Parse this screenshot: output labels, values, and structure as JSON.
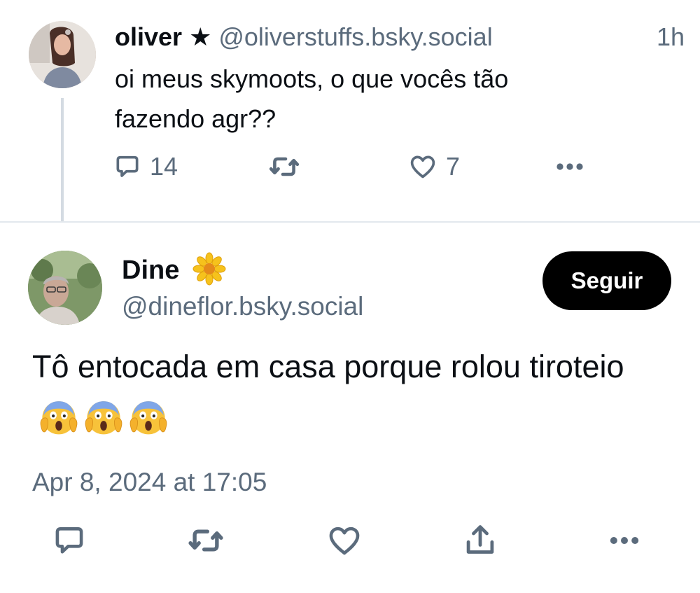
{
  "parent_post": {
    "author_name": "oliver",
    "author_star": "★",
    "author_handle": "@oliverstuffs.bsky.social",
    "time": "1h",
    "text": "oi meus skymoots, o que vocês tão fazendo agr??",
    "replies_count": "14",
    "likes_count": "7",
    "icons": {
      "reply": "speech-bubble-icon",
      "repost": "repost-arrows-icon",
      "like": "heart-icon",
      "more": "more-dots-icon"
    }
  },
  "main_post": {
    "author_name": "Dine",
    "name_emoji": "🌼",
    "author_handle": "@dineflor.bsky.social",
    "follow_label": "Seguir",
    "text": "Tô entocada em casa porque rolou tiroteio",
    "text_emojis": [
      "😱",
      "😱",
      "😱"
    ],
    "date": "Apr 8, 2024 at 17:05",
    "icons": {
      "reply": "speech-bubble-icon",
      "repost": "repost-arrows-icon",
      "like": "heart-icon",
      "share": "share-icon",
      "more": "more-dots-icon"
    }
  },
  "colors": {
    "text_primary": "#0b0f14",
    "text_secondary": "#5b6b7c",
    "icon": "#5b6b7c",
    "thread_line": "#d4dbe2",
    "divider": "#e3e8ed",
    "follow_bg": "#000000",
    "follow_text": "#ffffff",
    "flower_petal": "#f6c21c",
    "flower_center": "#e58a1a"
  }
}
